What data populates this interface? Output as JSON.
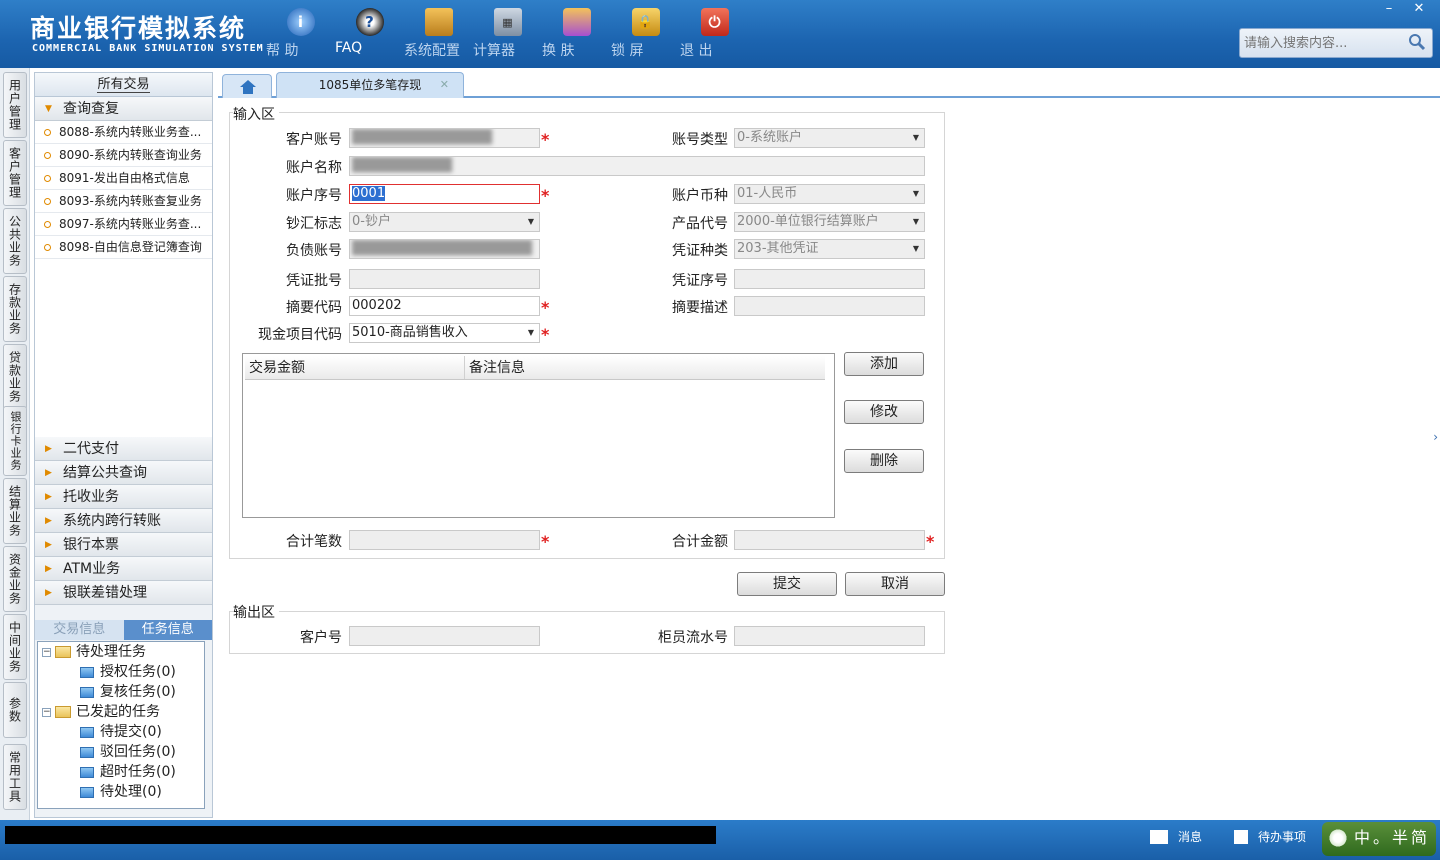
{
  "app": {
    "title_cn": "商业银行模拟系统",
    "title_en": "COMMERCIAL BANK SIMULATION SYSTEM"
  },
  "toolbar": [
    {
      "label": "帮 助",
      "icon": "info-icon"
    },
    {
      "label": "FAQ",
      "icon": "faq-icon"
    },
    {
      "label": "系统配置",
      "icon": "toolbox-icon"
    },
    {
      "label": "计算器",
      "icon": "calculator-icon"
    },
    {
      "label": "换 肤",
      "icon": "shirt-icon"
    },
    {
      "label": "锁 屏",
      "icon": "lock-icon"
    },
    {
      "label": "退 出",
      "icon": "power-icon"
    }
  ],
  "window": {
    "minimize": "–",
    "close": "✕"
  },
  "search": {
    "placeholder": "请输入搜索内容..."
  },
  "vnav": [
    "用户管理",
    "客户管理",
    "公共业务",
    "存款业务",
    "贷款业务",
    "银行卡业务",
    "结算业务",
    "资金业务",
    "中间业务",
    "参数",
    "常用工具"
  ],
  "left": {
    "header": "所有交易",
    "open_group": "查询查复",
    "items": [
      "8088-系统内转账业务查...",
      "8090-系统内转账查询业务",
      "8091-发出自由格式信息",
      "8093-系统内转账查复业务",
      "8097-系统内转账业务查...",
      "8098-自由信息登记簿查询"
    ],
    "groups": [
      "二代支付",
      "结算公共查询",
      "托收业务",
      "系统内跨行转账",
      "银行本票",
      "ATM业务",
      "银联差错处理"
    ],
    "task_tabs": [
      "交易信息",
      "任务信息"
    ],
    "tree": {
      "pending": "待处理任务",
      "authorize": "授权任务(0)",
      "review": "复核任务(0)",
      "initiated": "已发起的任务",
      "to_submit": "待提交(0)",
      "rejected": "驳回任务(0)",
      "timeout": "超时任务(0)",
      "to_process": "待处理(0)"
    }
  },
  "tabs": {
    "current": "1085单位多笔存现",
    "close": "✕"
  },
  "form": {
    "input_legend": "输入区",
    "output_legend": "输出区",
    "customer_account": {
      "label": "客户账号",
      "value": "██████████████"
    },
    "account_type": {
      "label": "账号类型",
      "value": "0-系统账户"
    },
    "account_name": {
      "label": "账户名称",
      "value": "██████████"
    },
    "account_seq": {
      "label": "账户序号",
      "value": "0001"
    },
    "account_currency": {
      "label": "账户币种",
      "value": "01-人民币"
    },
    "cash_flag": {
      "label": "钞汇标志",
      "value": "0-钞户"
    },
    "product_code": {
      "label": "产品代号",
      "value": "2000-单位银行结算账户"
    },
    "liability_account": {
      "label": "负债账号",
      "value": "██████████████████"
    },
    "voucher_type": {
      "label": "凭证种类",
      "value": "203-其他凭证"
    },
    "voucher_batch": {
      "label": "凭证批号",
      "value": ""
    },
    "voucher_seq": {
      "label": "凭证序号",
      "value": ""
    },
    "summary_code": {
      "label": "摘要代码",
      "value": "000202"
    },
    "summary_desc": {
      "label": "摘要描述",
      "value": ""
    },
    "cash_item_code": {
      "label": "现金项目代码",
      "value": "5010-商品销售收入"
    },
    "grid_columns": [
      "交易金额",
      "备注信息"
    ],
    "add_button": "添加",
    "edit_button": "修改",
    "delete_button": "删除",
    "total_count": {
      "label": "合计笔数",
      "value": ""
    },
    "total_amount": {
      "label": "合计金额",
      "value": ""
    },
    "submit_button": "提交",
    "cancel_button": "取消",
    "customer_no": {
      "label": "客户号",
      "value": ""
    },
    "teller_serial": {
      "label": "柜员流水号",
      "value": ""
    }
  },
  "status": {
    "messages": "消息",
    "todo": "待办事项",
    "ime": "中。半简"
  }
}
